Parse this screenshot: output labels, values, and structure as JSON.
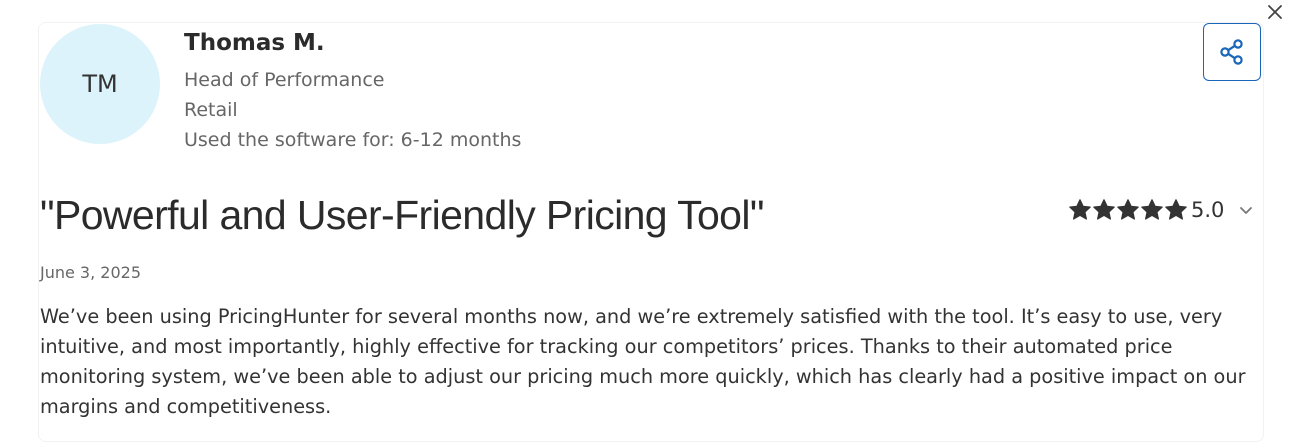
{
  "reviewer": {
    "initials": "TM",
    "name": "Thomas M.",
    "role": "Head of Performance",
    "industry": "Retail",
    "usage": "Used the software for: 6-12 months"
  },
  "review": {
    "title": "\"Powerful and User-Friendly Pricing Tool\"",
    "date": "June 3, 2025",
    "rating": 5,
    "rating_label": "5.0",
    "body": "We’ve been using PricingHunter for several months now, and we’re extremely satisfied with the tool. It’s easy to use, very intuitive, and most importantly, highly effective for tracking our competitors’ prices. Thanks to their automated price monitoring system, we’ve been able to adjust our pricing much more quickly, which has clearly had a positive impact on our margins and competitiveness."
  },
  "icons": {
    "close": "close-icon",
    "share": "share-icon",
    "star": "star-icon",
    "expand": "chevron-down-icon"
  },
  "colors": {
    "avatar_bg": "#dcf3fc",
    "accent": "#1a66b8",
    "star": "#333333",
    "muted_text": "#666666"
  }
}
